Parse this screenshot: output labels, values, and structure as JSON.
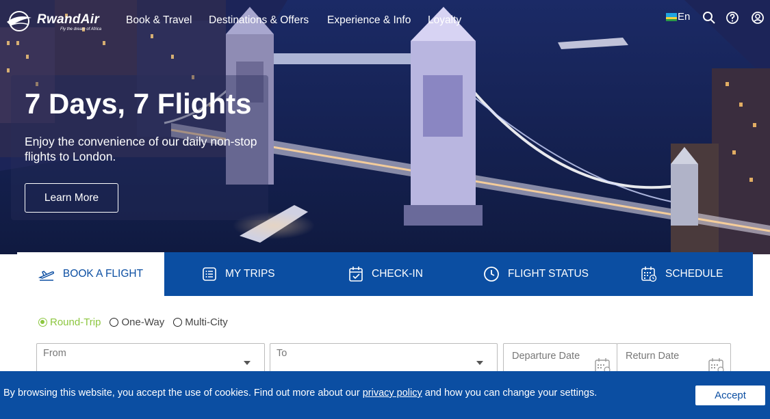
{
  "brand": {
    "name": "RwandAir",
    "tagline": "Fly the dream of Africa"
  },
  "nav": {
    "items": [
      "Book & Travel",
      "Destinations & Offers",
      "Experience & Info",
      "Loyalty"
    ],
    "language": "En",
    "icons": [
      "rwanda-flag-icon",
      "search-icon",
      "help-icon",
      "user-icon"
    ]
  },
  "hero": {
    "title": "7 Days, 7 Flights",
    "subtitle": "Enjoy the convenience of our daily non-stop flights to London.",
    "cta": "Learn More"
  },
  "booking": {
    "tabs": [
      {
        "label": "BOOK A FLIGHT",
        "icon": "plane-icon",
        "active": true
      },
      {
        "label": "MY TRIPS",
        "icon": "list-icon",
        "active": false
      },
      {
        "label": "CHECK-IN",
        "icon": "calendar-check-icon",
        "active": false
      },
      {
        "label": "FLIGHT STATUS",
        "icon": "clock-icon",
        "active": false
      },
      {
        "label": "SCHEDULE",
        "icon": "schedule-icon",
        "active": false
      }
    ],
    "trip_types": [
      {
        "label": "Round-Trip",
        "selected": true
      },
      {
        "label": "One-Way",
        "selected": false
      },
      {
        "label": "Multi-City",
        "selected": false
      }
    ],
    "from_label": "From",
    "to_label": "To",
    "departure_label": "Departure Date",
    "return_label": "Return Date"
  },
  "cookie": {
    "text_before": "By browsing this website, you accept the use of cookies. Find out more about our ",
    "link": "privacy policy",
    "text_after": " and how you can change your settings.",
    "accept": "Accept"
  },
  "colors": {
    "primary": "#0b4ea2",
    "accent": "#8cc63f"
  }
}
